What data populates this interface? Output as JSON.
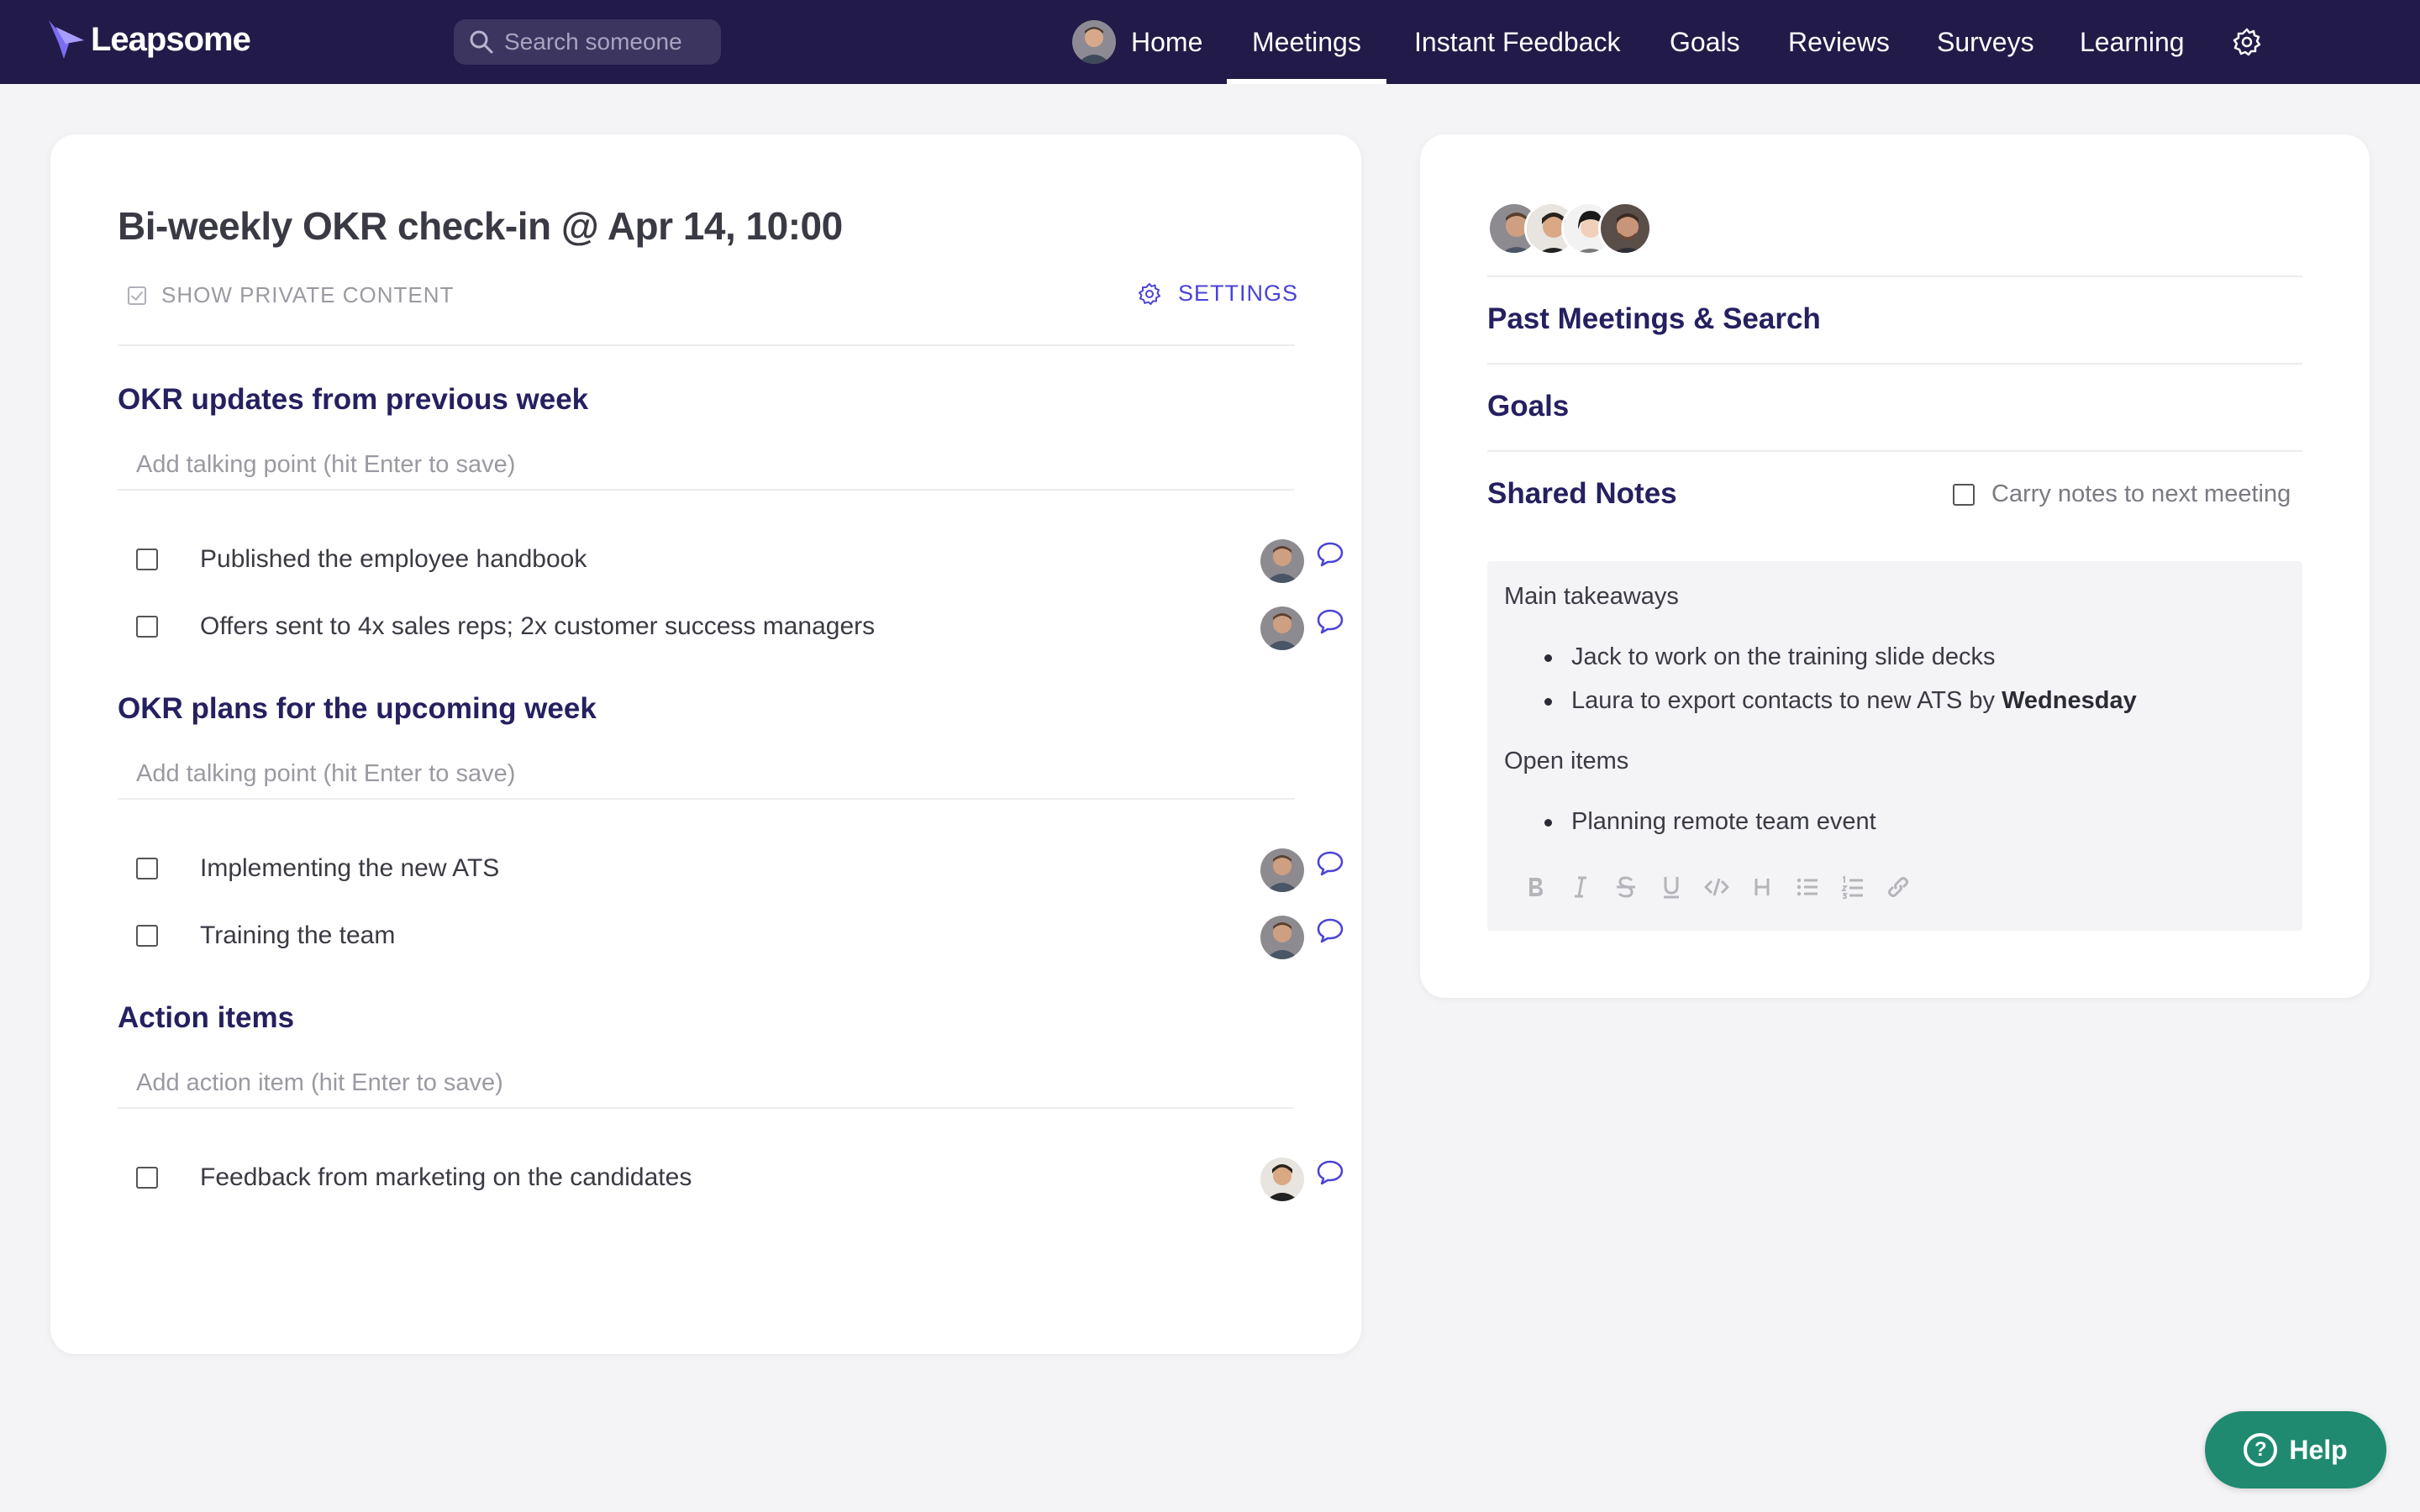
{
  "app": {
    "brand": "Leapsome"
  },
  "header": {
    "search_placeholder": "Search someone",
    "nav": [
      {
        "label": "Home"
      },
      {
        "label": "Meetings"
      },
      {
        "label": "Instant Feedback"
      },
      {
        "label": "Goals"
      },
      {
        "label": "Reviews"
      },
      {
        "label": "Surveys"
      },
      {
        "label": "Learning"
      }
    ],
    "active_nav": "Meetings"
  },
  "meeting": {
    "title": "Bi-weekly OKR check-in @ Apr 14, 10:00",
    "show_private_label": "SHOW PRIVATE CONTENT",
    "show_private_checked": true,
    "settings_label": "SETTINGS",
    "sections": [
      {
        "title": "OKR updates from previous week",
        "placeholder": "Add talking point (hit Enter to save)",
        "items": [
          {
            "label": "Published the employee handbook"
          },
          {
            "label": "Offers sent to 4x sales reps; 2x customer success managers"
          }
        ]
      },
      {
        "title": "OKR plans for the upcoming week",
        "placeholder": "Add talking point (hit Enter to save)",
        "items": [
          {
            "label": "Implementing the new ATS"
          },
          {
            "label": "Training the team"
          }
        ]
      },
      {
        "title": "Action items",
        "placeholder": "Add action item (hit Enter to save)",
        "items": [
          {
            "label": "Feedback from marketing on the candidates"
          }
        ]
      }
    ]
  },
  "sidebar": {
    "past_meetings_label": "Past Meetings & Search",
    "goals_label": "Goals",
    "shared_notes_label": "Shared Notes",
    "carry_notes_label": "Carry notes to next meeting",
    "notes": {
      "heading1": "Main takeaways",
      "bullets1": [
        {
          "text": "Jack to work on the training slide decks",
          "bold": ""
        },
        {
          "text": "Laura to export contacts to new ATS by ",
          "bold": "Wednesday"
        }
      ],
      "heading2": "Open items",
      "bullets2": [
        {
          "text": "Planning remote team event",
          "bold": ""
        }
      ],
      "toolbar": [
        "bold-icon",
        "italic-icon",
        "strikethrough-icon",
        "underline-icon",
        "code-icon",
        "heading-icon",
        "bullet-list-icon",
        "numbered-list-icon",
        "link-icon"
      ]
    }
  },
  "help": {
    "label": "Help"
  },
  "colors": {
    "nav_bg": "#221a48",
    "accent": "#4a43d6",
    "section_title": "#252060",
    "help_bg": "#1f8a70"
  }
}
